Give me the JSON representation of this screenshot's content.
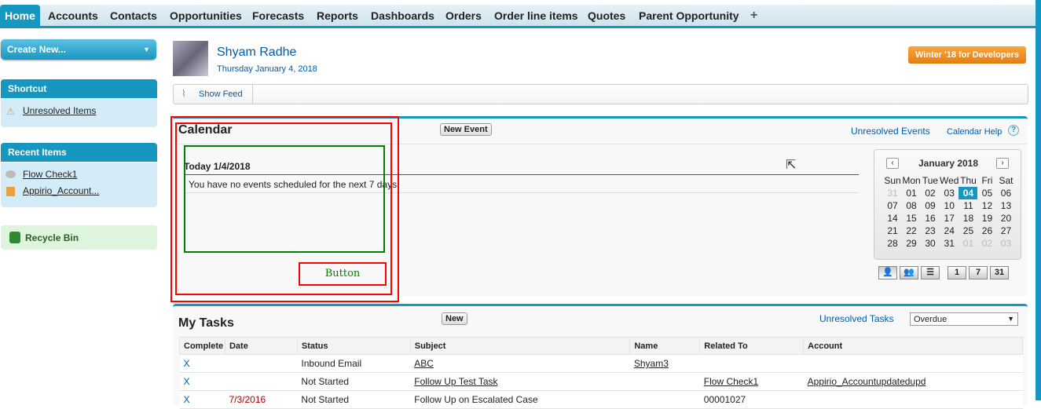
{
  "tabs": [
    "Home",
    "Accounts",
    "Contacts",
    "Opportunities",
    "Forecasts",
    "Reports",
    "Dashboards",
    "Orders",
    "Order line items",
    "Quotes",
    "Parent Opportunity",
    "+"
  ],
  "sidebar": {
    "create_new": "Create New...",
    "shortcut_title": "Shortcut",
    "shortcut_items": [
      "Unresolved Items"
    ],
    "recent_title": "Recent Items",
    "recent_items": [
      "Flow Check1",
      "Appirio_Account..."
    ],
    "recycle_bin": "Recycle Bin"
  },
  "header": {
    "user_name": "Shyam Radhe",
    "date": "Thursday January 4, 2018",
    "release_badge": "Winter '18 for Developers",
    "show_feed": "Show Feed"
  },
  "calendar": {
    "title": "Calendar",
    "new_event": "New Event",
    "unresolved_events": "Unresolved Events",
    "help": "Calendar Help",
    "today": "Today 1/4/2018",
    "no_events": "You have no events scheduled for the next 7 days",
    "annotation_button": "Button",
    "mini": {
      "month": "January 2018",
      "days": [
        "Sun",
        "Mon",
        "Tue",
        "Wed",
        "Thu",
        "Fri",
        "Sat"
      ],
      "weeks": [
        [
          "31",
          "01",
          "02",
          "03",
          "04",
          "05",
          "06"
        ],
        [
          "07",
          "08",
          "09",
          "10",
          "11",
          "12",
          "13"
        ],
        [
          "14",
          "15",
          "16",
          "17",
          "18",
          "19",
          "20"
        ],
        [
          "21",
          "22",
          "23",
          "24",
          "25",
          "26",
          "27"
        ],
        [
          "28",
          "29",
          "30",
          "31",
          "01",
          "02",
          "03"
        ]
      ],
      "selected": "04"
    },
    "views": [
      "1",
      "7",
      "31"
    ]
  },
  "tasks": {
    "title": "My Tasks",
    "new": "New",
    "unresolved": "Unresolved Tasks",
    "filter": "Overdue",
    "columns": [
      "Complete",
      "Date",
      "Status",
      "Subject",
      "Name",
      "Related To",
      "Account"
    ],
    "rows": [
      [
        "X",
        "",
        "Inbound Email",
        "ABC",
        "Shyam3",
        "",
        ""
      ],
      [
        "X",
        "",
        "Not Started",
        "Follow Up Test Task",
        "",
        "Flow Check1",
        "Appirio_Accountupdatedupd"
      ],
      [
        "X",
        "7/3/2016",
        "Not Started",
        "Follow Up on Escalated Case",
        "",
        "00001027",
        ""
      ]
    ]
  },
  "colors": {
    "accent": "#1797c0",
    "badge": "#f08a1c",
    "annotation_red": "#ff0000",
    "annotation_green": "#008000"
  }
}
